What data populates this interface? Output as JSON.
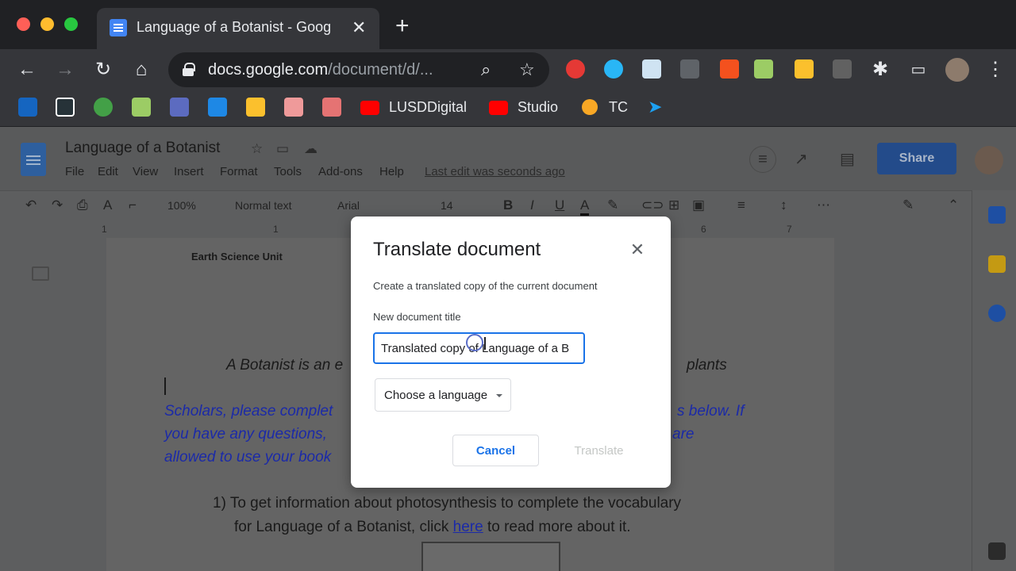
{
  "browser": {
    "tab_title": "Language of a Botanist - Goog",
    "url_host": "docs.google.com",
    "url_path": "/document/d/..."
  },
  "bookmarks": [
    {
      "label": "LUSDDigital"
    },
    {
      "label": "Studio"
    },
    {
      "label": "TC"
    }
  ],
  "docs": {
    "title": "Language of a Botanist",
    "menu": [
      "File",
      "Edit",
      "View",
      "Insert",
      "Format",
      "Tools",
      "Add-ons",
      "Help"
    ],
    "last_edit": "Last edit was seconds ago",
    "share_label": "Share",
    "toolbar": {
      "zoom": "100%",
      "style": "Normal text",
      "font": "Arial",
      "size": "14"
    },
    "ruler_numbers": [
      "1",
      "1",
      "6",
      "7"
    ],
    "content": {
      "unit_heading": "Earth Science Unit",
      "intro_left": "A Botanist is an e",
      "intro_right": "plants",
      "instr_l1_left": "Scholars, please complet",
      "instr_l1_right": "s below. If",
      "instr_l2_left": "you have any questions, ",
      "instr_l2_right": "are",
      "instr_l3_left": "allowed to use your book",
      "item1_line1": "1)  To get information about photosynthesis to complete the vocabulary",
      "item1_line2_pre": "for Language of a Botanist, click ",
      "item1_link": "here",
      "item1_line2_post": " to read more about it."
    }
  },
  "dialog": {
    "title": "Translate document",
    "description": "Create a translated copy of the current document",
    "field_label": "New document title",
    "field_value": "Translated copy of Language of a B",
    "language_select": "Choose a language",
    "cancel_label": "Cancel",
    "translate_label": "Translate"
  },
  "colors": {
    "accent": "#1a73e8",
    "share_button": "#234b8a",
    "instructions_text": "#1b2aa8"
  }
}
